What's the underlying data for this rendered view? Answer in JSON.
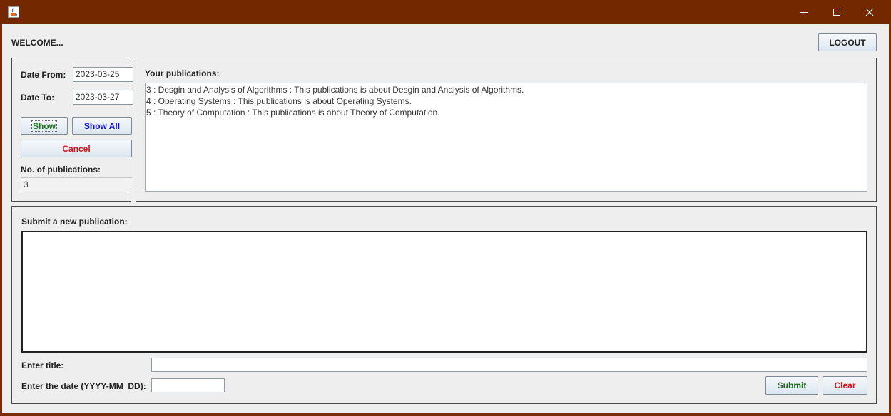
{
  "header": {
    "welcome": "WELCOME...",
    "logout_label": "LOGOUT"
  },
  "filter": {
    "date_from_label": "Date From:",
    "date_from_value": "2023-03-25",
    "date_to_label": "Date To:",
    "date_to_value": "2023-03-27",
    "show_label": "Show",
    "show_all_label": "Show All",
    "cancel_label": "Cancel",
    "count_label": "No. of publications:",
    "count_value": "3"
  },
  "publications": {
    "title": "Your publications:",
    "items": [
      "3 : Desgin and Analysis of Algorithms : This publications is about Desgin and Analysis of Algorithms.",
      "4 : Operating Systems : This publications is about Operating Systems.",
      "5 : Theory of Computation : This publications is about Theory of Computation."
    ]
  },
  "submit_form": {
    "title": "Submit a new publication:",
    "content_value": "",
    "title_label": "Enter title:",
    "title_value": "",
    "date_label": "Enter the date (YYYY-MM_DD):",
    "date_value": "",
    "submit_label": "Submit",
    "clear_label": "Clear"
  },
  "colors": {
    "titlebar": "#742800",
    "show_text": "#1a7a1a",
    "show_all_text": "#1010c8",
    "cancel_text": "#e0101a",
    "submit_text": "#1a6a1a",
    "clear_text": "#e0101a"
  },
  "icons": {
    "app": "java-cup-icon",
    "minimize": "minimize-icon",
    "maximize": "maximize-icon",
    "close": "close-icon"
  }
}
